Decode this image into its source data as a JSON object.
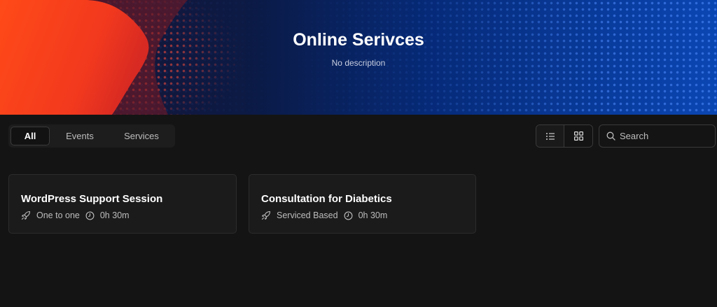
{
  "hero": {
    "title": "Online Serivces",
    "subtitle": "No description"
  },
  "filters": {
    "tabs": [
      {
        "label": "All",
        "active": true
      },
      {
        "label": "Events",
        "active": false
      },
      {
        "label": "Services",
        "active": false
      }
    ]
  },
  "view_toggle": {
    "list_icon": "list-icon",
    "grid_icon": "grid-icon"
  },
  "search": {
    "placeholder": "Search",
    "value": ""
  },
  "cards": [
    {
      "title": "WordPress Support Session",
      "type": "One to one",
      "duration": "0h 30m"
    },
    {
      "title": "Consultation for Diabetics",
      "type": "Serviced Based",
      "duration": "0h 30m"
    }
  ],
  "colors": {
    "background": "#141414",
    "hero_orange": "#ff3d1f",
    "hero_blue": "#0a46b3"
  }
}
